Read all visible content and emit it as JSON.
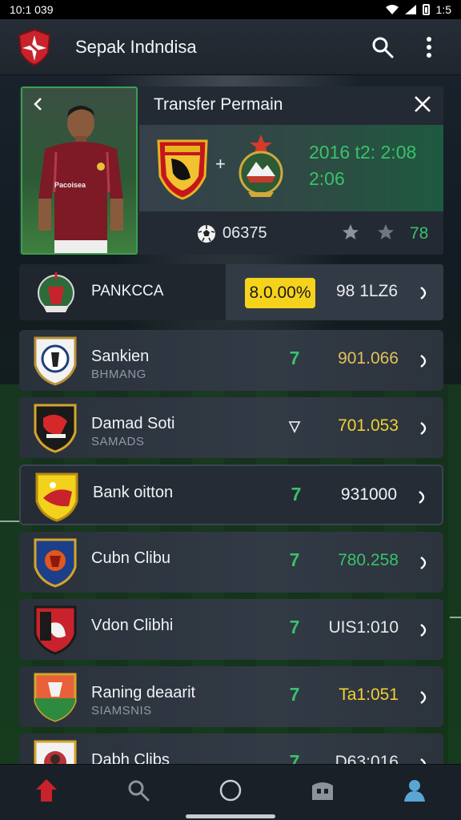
{
  "status_bar": {
    "time": "10:1 039",
    "battery": "1:5"
  },
  "app_bar": {
    "title": "Sepak Indndisa",
    "icons": [
      "app-logo-icon",
      "search-icon",
      "more-vert-icon"
    ]
  },
  "transfer_card": {
    "title": "Transfer Permain",
    "shirt_sponsor": "Pacoisea",
    "date_line1": "2016 t2: 2:08",
    "date_line2": "2:06",
    "fee": "06375",
    "rating": "78",
    "colors": {
      "accent_green": "#39c26a",
      "photo_border": "#3aa04e"
    }
  },
  "featured_club": {
    "name": "PANKCCA",
    "badge": "8.0.00%",
    "value": "98 1LZ6",
    "badge_color": "#f5d21c"
  },
  "clubs": [
    {
      "name": "Sankien",
      "sub": "BHMANG",
      "trend": "7",
      "value": "901.066",
      "value_color": "#e0c25a"
    },
    {
      "name": "Damad Soti",
      "sub": "SAMADS",
      "trend": "▽",
      "value": "701.053",
      "value_color": "#f0d033"
    },
    {
      "name": "Bank oitton",
      "sub": "",
      "trend": "7",
      "value": "931000",
      "value_color": "#f2f4f7"
    },
    {
      "name": "Cubn Clibu",
      "sub": "",
      "trend": "7",
      "value": "780.258",
      "value_color": "#39c26a"
    },
    {
      "name": "Vdon Clibhi",
      "sub": "",
      "trend": "7",
      "value": "UIS1:010",
      "value_color": "#e6e9ec"
    },
    {
      "name": "Raning deaarit",
      "sub": "SIAMSNIS",
      "trend": "7",
      "value": "Ta1:051",
      "value_color": "#f0d033"
    },
    {
      "name": "Dabh Clibs",
      "sub": "",
      "trend": "7",
      "value": "D63:016",
      "value_color": "#e6e9ec"
    }
  ],
  "bottom_nav": {
    "items": [
      "transfer-home-icon",
      "search-icon",
      "circle-icon",
      "stadium-icon",
      "profile-icon"
    ],
    "active": "profile-icon",
    "active_color": "#58a6d6"
  }
}
